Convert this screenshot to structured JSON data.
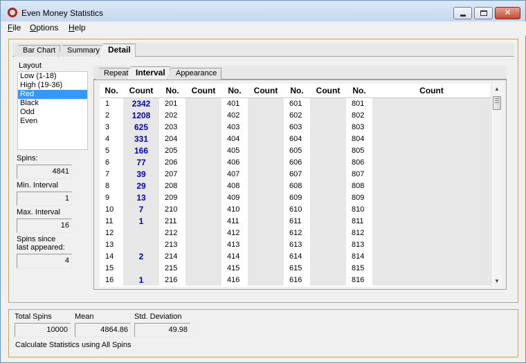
{
  "window": {
    "title": "Even Money  Statistics"
  },
  "menu": [
    {
      "underlined": "F",
      "rest": "ile"
    },
    {
      "underlined": "O",
      "rest": "ptions"
    },
    {
      "underlined": "H",
      "rest": "elp"
    }
  ],
  "tabs": [
    "Bar Chart",
    "Summary",
    "Detail"
  ],
  "sidebar": {
    "layout_label": "Layout",
    "layout_items": [
      "Low (1-18)",
      "High (19-36)",
      "Red",
      "Black",
      "Odd",
      "Even"
    ],
    "selected": "Red",
    "spins_label": "Spins:",
    "spins_value": "4841",
    "min_interval_label": "Min. Interval",
    "min_interval_value": "1",
    "max_interval_label": "Max. Interval",
    "max_interval_value": "16",
    "since_label_1": "Spins since",
    "since_label_2": "last appeared:",
    "since_value": "4"
  },
  "inner_tabs": [
    "Repeat",
    "Interval",
    "Appearance"
  ],
  "grid": {
    "headers": [
      "No.",
      "Count",
      "No.",
      "Count",
      "No.",
      "Count",
      "No.",
      "Count",
      "No.",
      "Count"
    ],
    "rows": [
      [
        "1",
        "2342",
        "201",
        "",
        "401",
        "",
        "601",
        "",
        "801",
        ""
      ],
      [
        "2",
        "1208",
        "202",
        "",
        "402",
        "",
        "602",
        "",
        "802",
        ""
      ],
      [
        "3",
        "625",
        "203",
        "",
        "403",
        "",
        "603",
        "",
        "803",
        ""
      ],
      [
        "4",
        "331",
        "204",
        "",
        "404",
        "",
        "604",
        "",
        "804",
        ""
      ],
      [
        "5",
        "166",
        "205",
        "",
        "405",
        "",
        "605",
        "",
        "805",
        ""
      ],
      [
        "6",
        "77",
        "206",
        "",
        "406",
        "",
        "606",
        "",
        "806",
        ""
      ],
      [
        "7",
        "39",
        "207",
        "",
        "407",
        "",
        "607",
        "",
        "807",
        ""
      ],
      [
        "8",
        "29",
        "208",
        "",
        "408",
        "",
        "608",
        "",
        "808",
        ""
      ],
      [
        "9",
        "13",
        "209",
        "",
        "409",
        "",
        "609",
        "",
        "809",
        ""
      ],
      [
        "10",
        "7",
        "210",
        "",
        "410",
        "",
        "610",
        "",
        "810",
        ""
      ],
      [
        "11",
        "1",
        "211",
        "",
        "411",
        "",
        "611",
        "",
        "811",
        ""
      ],
      [
        "12",
        "",
        "212",
        "",
        "412",
        "",
        "612",
        "",
        "812",
        ""
      ],
      [
        "13",
        "",
        "213",
        "",
        "413",
        "",
        "613",
        "",
        "813",
        ""
      ],
      [
        "14",
        "2",
        "214",
        "",
        "414",
        "",
        "614",
        "",
        "814",
        ""
      ],
      [
        "15",
        "",
        "215",
        "",
        "415",
        "",
        "615",
        "",
        "815",
        ""
      ],
      [
        "16",
        "1",
        "216",
        "",
        "416",
        "",
        "616",
        "",
        "816",
        ""
      ]
    ]
  },
  "footer": {
    "total_label": "Total Spins",
    "total_value": "10000",
    "mean_label": "Mean",
    "mean_value": "4864.86",
    "std_label": "Std. Deviation",
    "std_value": "49.98",
    "note": "Calculate Statistics using All Spins"
  }
}
